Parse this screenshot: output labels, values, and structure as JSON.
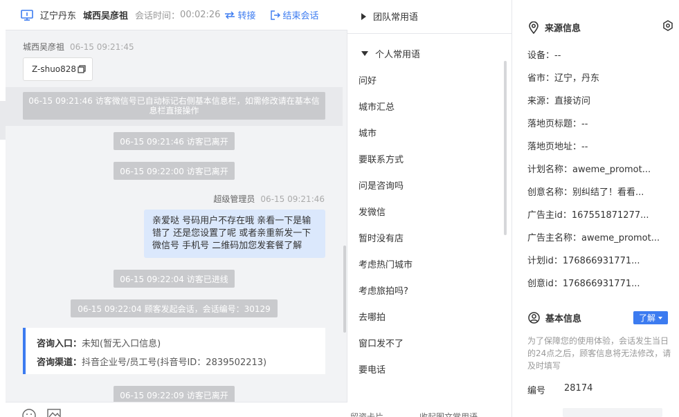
{
  "header": {
    "location": "辽宁丹东",
    "visitor_name": "城西吴彦祖",
    "session_time_label": "会话时间：",
    "session_time": "00:02:26",
    "transfer_label": "转接",
    "end_label": "结束会话"
  },
  "chat": {
    "visitor_msg": {
      "sender": "城西吴彦祖",
      "time": "06-15 09:21:45",
      "text": "Z-shuo828"
    },
    "notice": "06-15 09:21:46 访客微信号已自动标记右侧基本信息栏，如需修改请在基本信息栏直接操作",
    "system": [
      "06-15 09:21:46 访客已离开",
      "06-15 09:22:00 访客已离开",
      "06-15 09:22:04 访客已进线",
      "06-15 09:22:04 顾客发起会话，会话编号：30129",
      "06-15 09:22:09 访客已离开"
    ],
    "agent_msg": {
      "sender": "超级管理员",
      "time": "06-15 09:21:46",
      "text": "亲爱哒 号码用户不存在哦 亲看一下是输错了 还是您设置了呢 或者亲重新发一下微信号 手机号 二维码加您发套餐了解"
    },
    "info_card": {
      "entry_label": "咨询入口：",
      "entry_value": "未知(暂无入口信息)",
      "channel_label": "咨询渠道：",
      "channel_value": "抖音企业号/员工号(抖音号ID：2839502213)"
    }
  },
  "phrases": {
    "team_group": "团队常用语",
    "personal_group": "个人常用语",
    "items": [
      "问好",
      "城市汇总",
      "城市",
      "要联系方式",
      "问是咨询吗",
      "发微信",
      "暂时没有店",
      "考虑热门城市",
      "考虑旅拍吗?",
      "去哪拍",
      "窗口发不了",
      "要电话"
    ],
    "footer_left": "留资卡片",
    "footer_right": "收起图文常用语"
  },
  "source": {
    "title": "来源信息",
    "fields": [
      "设备：--",
      "省市：辽宁，丹东",
      "来源：直接访问",
      "落地页标题：--",
      "落地页地址：--",
      "计划名称：aweme_promot...",
      "创意名称：别纠结了！看看...",
      "广告主id：167551871277...",
      "广告主名称：aweme_promot...",
      "计划id：176866931771...",
      "创意id：176866931771..."
    ],
    "basic_title": "基本信息",
    "learn_label": "了解",
    "note": "为了保障您的使用体验，会话发生当日的24点之后，顾客信息将无法修改，请及时填写",
    "id_label": "编号",
    "id_value": "28174"
  }
}
